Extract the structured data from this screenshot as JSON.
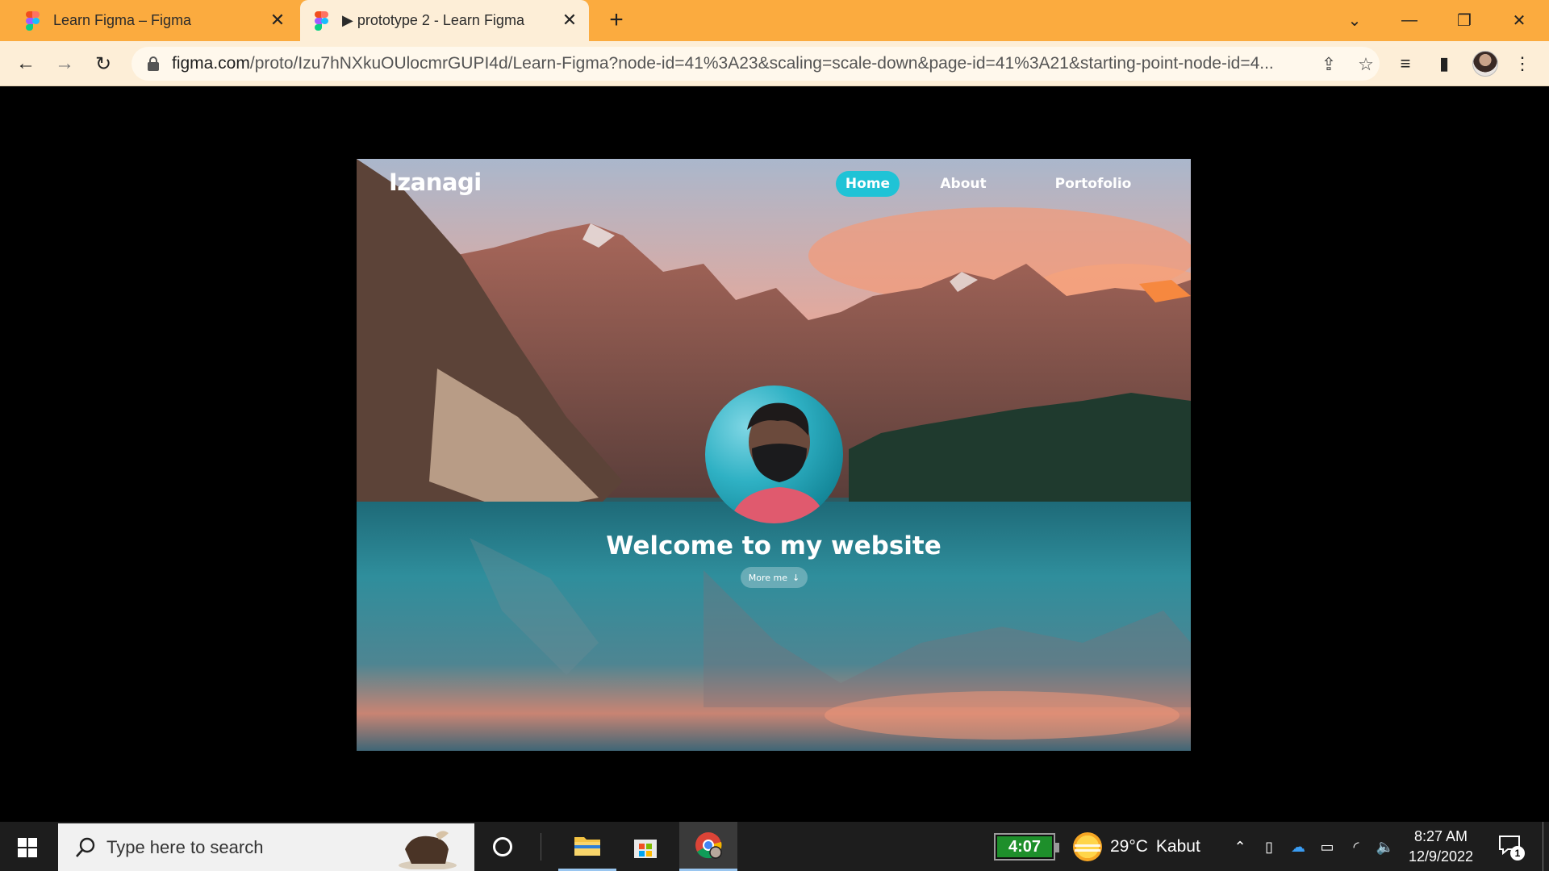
{
  "browser": {
    "tabs": [
      {
        "title": "Learn Figma – Figma",
        "active": false
      },
      {
        "title": "▶ prototype 2 - Learn Figma",
        "active": true
      }
    ],
    "new_tab_icon": "plus-icon",
    "address": {
      "host": "figma.com",
      "path": "/proto/Izu7hNXkuOUlocmrGUPI4d/Learn-Figma?node-id=41%3A23&scaling=scale-down&page-id=41%3A21&starting-point-node-id=4..."
    },
    "accent_color": "#fbab3f"
  },
  "site": {
    "logo": "Izanagi",
    "nav": [
      {
        "label": "Home",
        "active": true
      },
      {
        "label": "About",
        "active": false
      },
      {
        "label": "Portofolio",
        "active": false
      }
    ],
    "headline": "Welcome to my website",
    "cta_label": "More me",
    "accent_color": "#1fc3d6"
  },
  "taskbar": {
    "search_placeholder": "Type here to search",
    "battery_widget": "4:07",
    "weather": {
      "temp": "29°C",
      "condition": "Kabut"
    },
    "time": "8:27 AM",
    "date": "12/9/2022",
    "notification_count": "1"
  }
}
